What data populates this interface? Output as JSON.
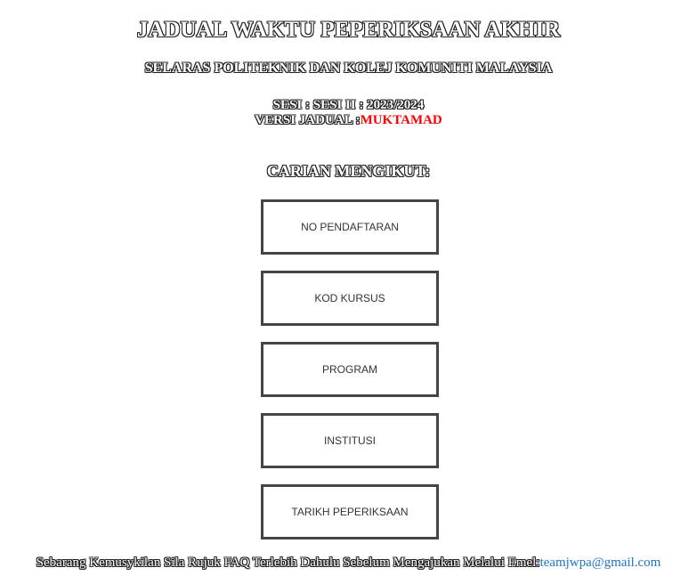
{
  "header": {
    "title": "JADUAL WAKTU PEPERIKSAAN AKHIR",
    "subtitle": "SELARAS POLITEKNIK DAN KOLEJ KOMUNITI MALAYSIA",
    "session": "SESI : SESI II : 2023/2024",
    "version_label": "VERSI JADUAL :",
    "version_status": "MUKTAMAD",
    "version_status_color": "#ff0000"
  },
  "search": {
    "heading": "CARIAN MENGIKUT:",
    "buttons": [
      "NO PENDAFTARAN",
      "KOD KURSUS",
      "PROGRAM",
      "INSTITUSI",
      "TARIKH PEPERIKSAAN"
    ]
  },
  "footer": {
    "text": "Sebarang Kemusykilan Sila Rujuk FAQ Terlebih Dahulu Sebelum Mengajukan Melalui Emel:",
    "email": "teamjwpa@gmail.com",
    "email_color": "#1a73c8"
  }
}
